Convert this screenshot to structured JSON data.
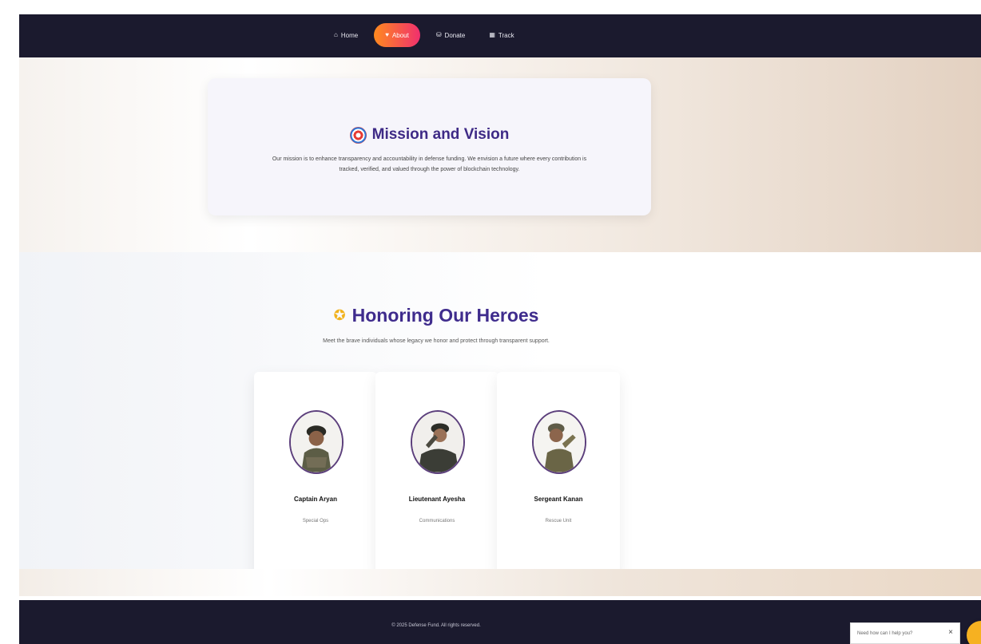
{
  "nav": {
    "items": [
      {
        "label": "Home",
        "icon": "home-icon",
        "active": false
      },
      {
        "label": "About",
        "icon": "heart-icon",
        "active": true
      },
      {
        "label": "Donate",
        "icon": "donate-icon",
        "active": false
      },
      {
        "label": "Track",
        "icon": "track-icon",
        "active": false
      }
    ]
  },
  "mission": {
    "title": "Mission and Vision",
    "text": "Our mission is to enhance transparency and accountability in defense funding. We envision a future where every contribution is tracked, verified, and valued through the power of blockchain technology."
  },
  "heroes": {
    "title": "Honoring Our Heroes",
    "subtitle": "Meet the brave individuals whose legacy we honor and protect through transparent support.",
    "cards": [
      {
        "name": "Captain Aryan",
        "role": "Special Ops"
      },
      {
        "name": "Lieutenant Ayesha",
        "role": "Communications"
      },
      {
        "name": "Sergeant Kanan",
        "role": "Rescue Unit"
      }
    ]
  },
  "footer": {
    "text": "© 2025 Defense Fund. All rights reserved."
  },
  "chat": {
    "placeholder": "Need how can I help you?",
    "close": "×"
  },
  "colors": {
    "nav_bg": "#1b1a2e",
    "accent_start": "#ff8a1f",
    "accent_end": "#f0306e",
    "title_purple": "#3e2a86",
    "chat_button": "#f6b121"
  }
}
